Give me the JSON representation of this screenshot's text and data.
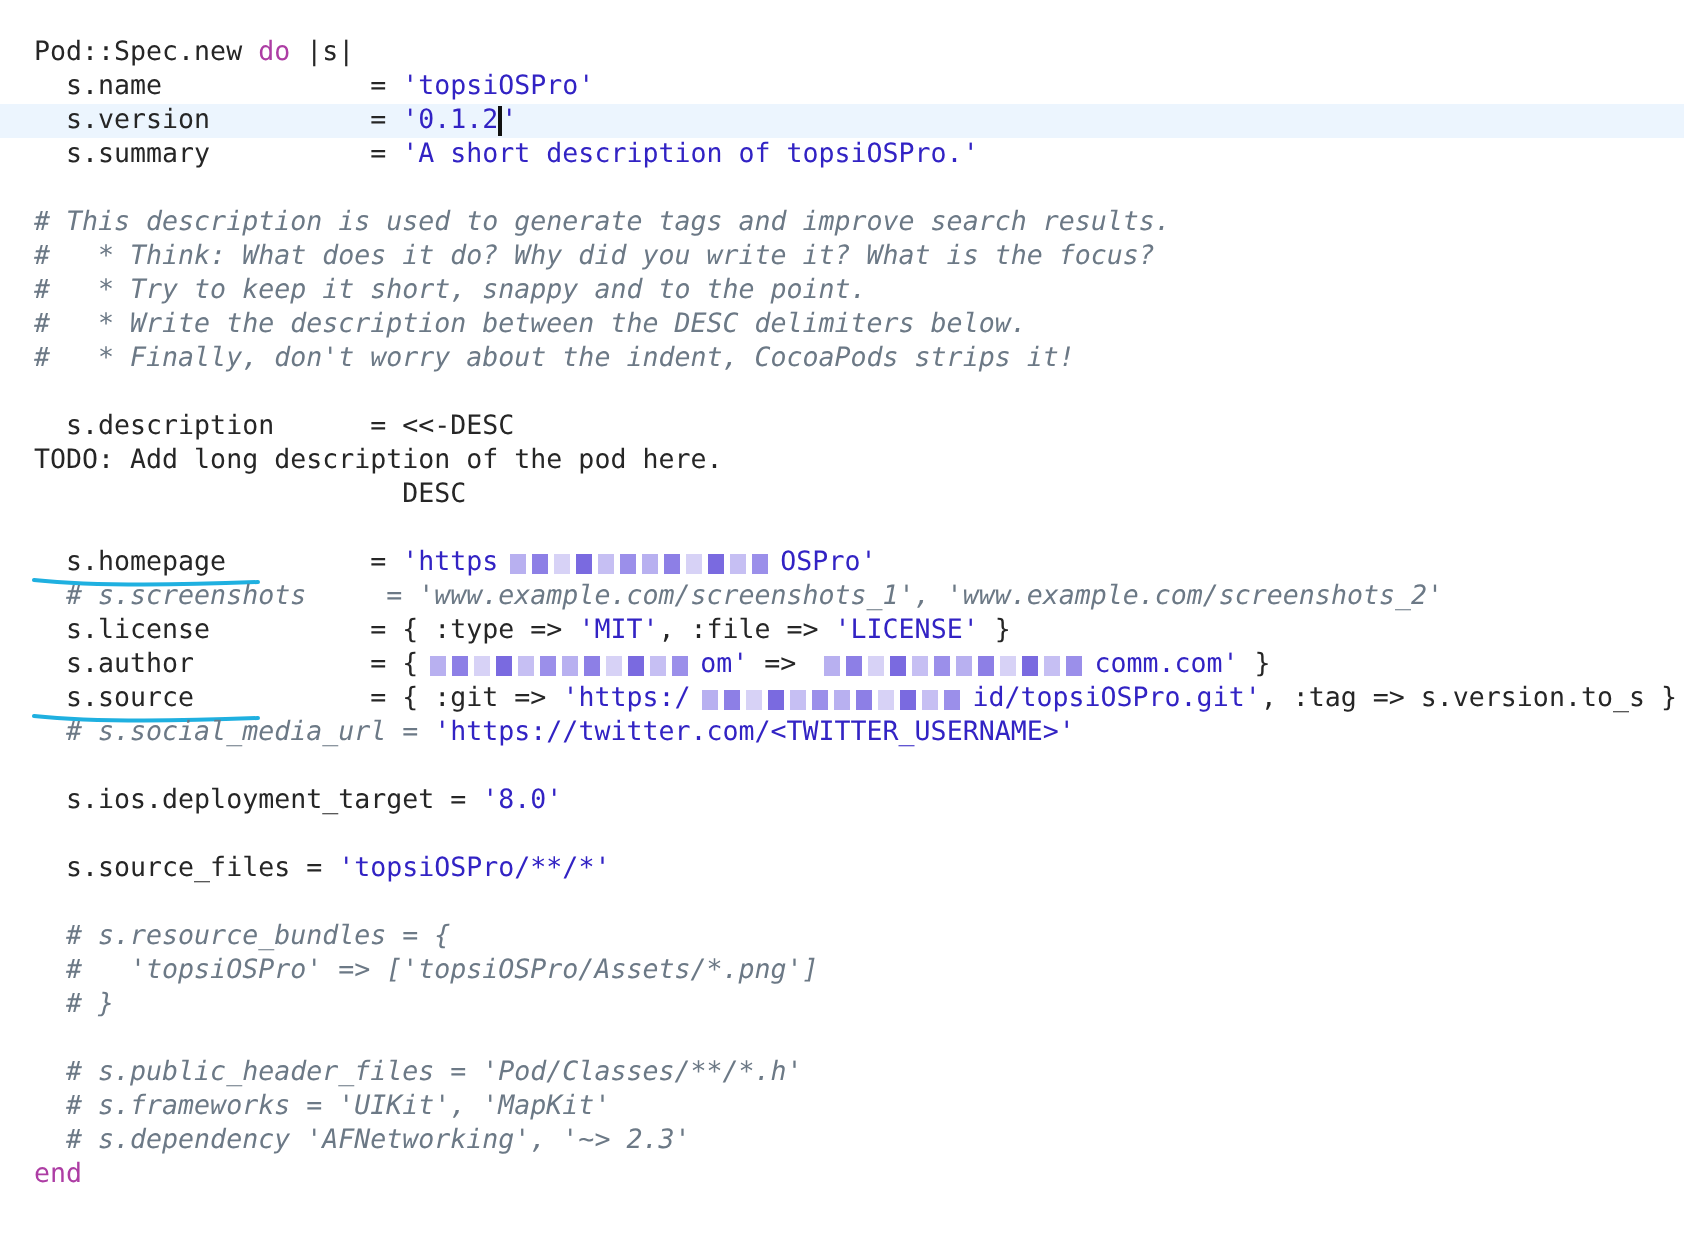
{
  "editor": {
    "lines": [
      {
        "current": false,
        "underlined": false
      },
      {
        "current": false,
        "underlined": false,
        "segments": [
          {
            "kind": "plain",
            "text": "Pod::Spec.new "
          },
          {
            "kind": "keyword",
            "text": "do"
          },
          {
            "kind": "plain",
            "text": " |s|"
          }
        ]
      },
      {
        "current": false,
        "underlined": false,
        "segments": [
          {
            "kind": "plain",
            "text": "  s.name             = "
          },
          {
            "kind": "string",
            "text": "'topsiOSPro'"
          }
        ]
      },
      {
        "current": true,
        "underlined": false,
        "segments": [
          {
            "kind": "plain",
            "text": "  s.version          = "
          },
          {
            "kind": "string",
            "text": "'0.1.2"
          },
          {
            "kind": "cursor"
          },
          {
            "kind": "string",
            "text": "'"
          }
        ]
      },
      {
        "current": false,
        "underlined": false,
        "segments": [
          {
            "kind": "plain",
            "text": "  s.summary          = "
          },
          {
            "kind": "string",
            "text": "'A short description of topsiOSPro.'"
          }
        ]
      },
      {
        "current": false,
        "underlined": false
      },
      {
        "current": false,
        "underlined": false,
        "segments": [
          {
            "kind": "comment",
            "text": "# This description is used to generate tags and improve search results."
          }
        ]
      },
      {
        "current": false,
        "underlined": false,
        "segments": [
          {
            "kind": "comment",
            "text": "#   * Think: What does it do? Why did you write it? What is the focus?"
          }
        ]
      },
      {
        "current": false,
        "underlined": false,
        "segments": [
          {
            "kind": "comment",
            "text": "#   * Try to keep it short, snappy and to the point."
          }
        ]
      },
      {
        "current": false,
        "underlined": false,
        "segments": [
          {
            "kind": "comment",
            "text": "#   * Write the description between the DESC delimiters below."
          }
        ]
      },
      {
        "current": false,
        "underlined": false,
        "segments": [
          {
            "kind": "comment",
            "text": "#   * Finally, don't worry about the indent, CocoaPods strips it!"
          }
        ]
      },
      {
        "current": false,
        "underlined": false
      },
      {
        "current": false,
        "underlined": false,
        "segments": [
          {
            "kind": "plain",
            "text": "  s.description      = <<-DESC"
          }
        ]
      },
      {
        "current": false,
        "underlined": false,
        "segments": [
          {
            "kind": "plain",
            "text": "TODO: Add long description of the pod here."
          }
        ]
      },
      {
        "current": false,
        "underlined": false,
        "segments": [
          {
            "kind": "plain",
            "text": "                       DESC"
          }
        ]
      },
      {
        "current": false,
        "underlined": false
      },
      {
        "current": false,
        "underlined": true,
        "segments": [
          {
            "kind": "plain",
            "text": "  s.homepage         = "
          },
          {
            "kind": "string",
            "text": "'https"
          },
          {
            "kind": "redacted"
          },
          {
            "kind": "string",
            "text": "OSPro'"
          }
        ]
      },
      {
        "current": false,
        "underlined": false,
        "segments": [
          {
            "kind": "comment",
            "text": "  # s.screenshots     = 'www.example.com/screenshots_1', 'www.example.com/screenshots_2'"
          }
        ]
      },
      {
        "current": false,
        "underlined": false,
        "segments": [
          {
            "kind": "plain",
            "text": "  s.license          = { :type => "
          },
          {
            "kind": "string",
            "text": "'MIT'"
          },
          {
            "kind": "plain",
            "text": ", :file => "
          },
          {
            "kind": "string",
            "text": "'LICENSE'"
          },
          {
            "kind": "plain",
            "text": " }"
          }
        ]
      },
      {
        "current": false,
        "underlined": false,
        "segments": [
          {
            "kind": "plain",
            "text": "  s.author           = {"
          },
          {
            "kind": "redacted"
          },
          {
            "kind": "string",
            "text": "om'"
          },
          {
            "kind": "plain",
            "text": " => "
          },
          {
            "kind": "redacted"
          },
          {
            "kind": "string",
            "text": "comm.com'"
          },
          {
            "kind": "plain",
            "text": " }"
          }
        ]
      },
      {
        "current": false,
        "underlined": true,
        "segments": [
          {
            "kind": "plain",
            "text": "  s.source           = { :git => "
          },
          {
            "kind": "string",
            "text": "'https:/"
          },
          {
            "kind": "redacted"
          },
          {
            "kind": "string",
            "text": "id/topsiOSPro.git'"
          },
          {
            "kind": "plain",
            "text": ", :tag => s.version.to_s }"
          }
        ]
      },
      {
        "current": false,
        "underlined": false,
        "segments": [
          {
            "kind": "comment",
            "text": "  # s.social_media_url = "
          },
          {
            "kind": "string",
            "text": "'https://twitter.com/<TWITTER_USERNAME>'"
          }
        ]
      },
      {
        "current": false,
        "underlined": false
      },
      {
        "current": false,
        "underlined": false,
        "segments": [
          {
            "kind": "plain",
            "text": "  s.ios.deployment_target = "
          },
          {
            "kind": "string",
            "text": "'8.0'"
          }
        ]
      },
      {
        "current": false,
        "underlined": false
      },
      {
        "current": false,
        "underlined": false,
        "segments": [
          {
            "kind": "plain",
            "text": "  s.source_files = "
          },
          {
            "kind": "string",
            "text": "'topsiOSPro/**/*'"
          }
        ]
      },
      {
        "current": false,
        "underlined": false
      },
      {
        "current": false,
        "underlined": false,
        "segments": [
          {
            "kind": "comment",
            "text": "  # s.resource_bundles = {"
          }
        ]
      },
      {
        "current": false,
        "underlined": false,
        "segments": [
          {
            "kind": "comment",
            "text": "  #   'topsiOSPro' => ['topsiOSPro/Assets/*.png']"
          }
        ]
      },
      {
        "current": false,
        "underlined": false,
        "segments": [
          {
            "kind": "comment",
            "text": "  # }"
          }
        ]
      },
      {
        "current": false,
        "underlined": false
      },
      {
        "current": false,
        "underlined": false,
        "segments": [
          {
            "kind": "comment",
            "text": "  # s.public_header_files = 'Pod/Classes/**/*.h'"
          }
        ]
      },
      {
        "current": false,
        "underlined": false,
        "segments": [
          {
            "kind": "comment",
            "text": "  # s.frameworks = 'UIKit', 'MapKit'"
          }
        ]
      },
      {
        "current": false,
        "underlined": false,
        "segments": [
          {
            "kind": "comment",
            "text": "  # s.dependency 'AFNetworking', '~> 2.3'"
          }
        ]
      },
      {
        "current": false,
        "underlined": false,
        "segments": [
          {
            "kind": "keyword",
            "text": "end"
          }
        ]
      },
      {
        "current": false,
        "underlined": false
      }
    ]
  }
}
